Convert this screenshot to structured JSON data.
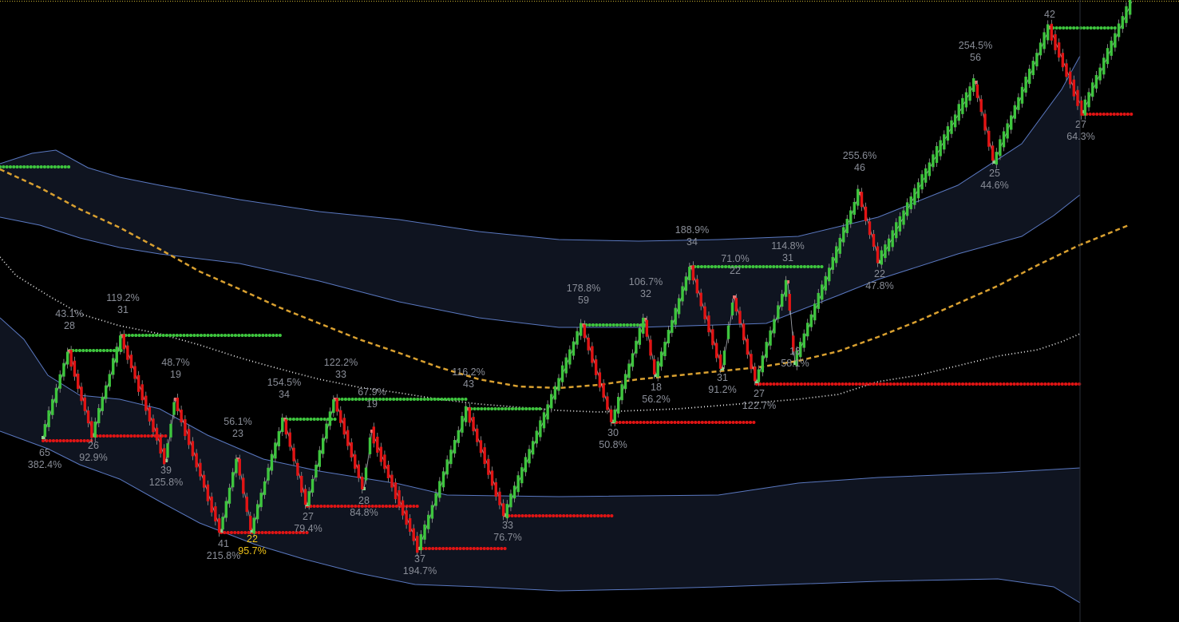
{
  "colors": {
    "background": "#000000",
    "bullish": "#3ec53e",
    "bearish": "#e11414",
    "band_fill": "#0f1420",
    "band_line": "#5a78c0",
    "ma_dashed": "#d9a030",
    "ma_dotted": "#e8e8e8",
    "label": "#8a8e98",
    "label_highlight": "#f0c419",
    "wick": "#9a9a9a",
    "top_border": "#c8b030"
  },
  "chart_data": {
    "type": "line",
    "description_type": "renko-style price bricks with zigzag swing labels",
    "swing_points": [
      {
        "count": "65",
        "pct": "382.4%",
        "kind": "low"
      },
      {
        "count": "28",
        "pct": "43.1%",
        "kind": "high"
      },
      {
        "count": "26",
        "pct": "92.9%",
        "kind": "low"
      },
      {
        "count": "31",
        "pct": "119.2%",
        "kind": "high"
      },
      {
        "count": "39",
        "pct": "125.8%",
        "kind": "low"
      },
      {
        "count": "19",
        "pct": "48.7%",
        "kind": "high"
      },
      {
        "count": "41",
        "pct": "215.8%",
        "kind": "low"
      },
      {
        "count": "23",
        "pct": "56.1%",
        "kind": "high"
      },
      {
        "count": "22",
        "pct": "95.7%",
        "kind": "low",
        "highlight": true
      },
      {
        "count": "34",
        "pct": "154.5%",
        "kind": "high"
      },
      {
        "count": "27",
        "pct": "79.4%",
        "kind": "low"
      },
      {
        "count": "33",
        "pct": "122.2%",
        "kind": "high"
      },
      {
        "count": "28",
        "pct": "84.8%",
        "kind": "low"
      },
      {
        "count": "19",
        "pct": "67.9%",
        "kind": "high"
      },
      {
        "count": "37",
        "pct": "194.7%",
        "kind": "low"
      },
      {
        "count": "43",
        "pct": "116.2%",
        "kind": "high"
      },
      {
        "count": "33",
        "pct": "76.7%",
        "kind": "low"
      },
      {
        "count": "59",
        "pct": "178.8%",
        "kind": "high"
      },
      {
        "count": "30",
        "pct": "50.8%",
        "kind": "low"
      },
      {
        "count": "32",
        "pct": "106.7%",
        "kind": "high"
      },
      {
        "count": "18",
        "pct": "56.2%",
        "kind": "low"
      },
      {
        "count": "34",
        "pct": "188.9%",
        "kind": "high"
      },
      {
        "count": "31",
        "pct": "91.2%",
        "kind": "low"
      },
      {
        "count": "22",
        "pct": "71.0%",
        "kind": "high"
      },
      {
        "count": "27",
        "pct": "122.7%",
        "kind": "low"
      },
      {
        "count": "31",
        "pct": "114.8%",
        "kind": "high"
      },
      {
        "count": "18",
        "pct": "58.1%",
        "kind": "low"
      },
      {
        "count": "46",
        "pct": "255.6%",
        "kind": "high"
      },
      {
        "count": "22",
        "pct": "47.8%",
        "kind": "low"
      },
      {
        "count": "56",
        "pct": "254.5%",
        "kind": "high"
      },
      {
        "count": "25",
        "pct": "44.6%",
        "kind": "low"
      },
      {
        "count": "42",
        "pct": "",
        "kind": "high"
      },
      {
        "count": "27",
        "pct": "64.3%",
        "kind": "low"
      }
    ]
  }
}
